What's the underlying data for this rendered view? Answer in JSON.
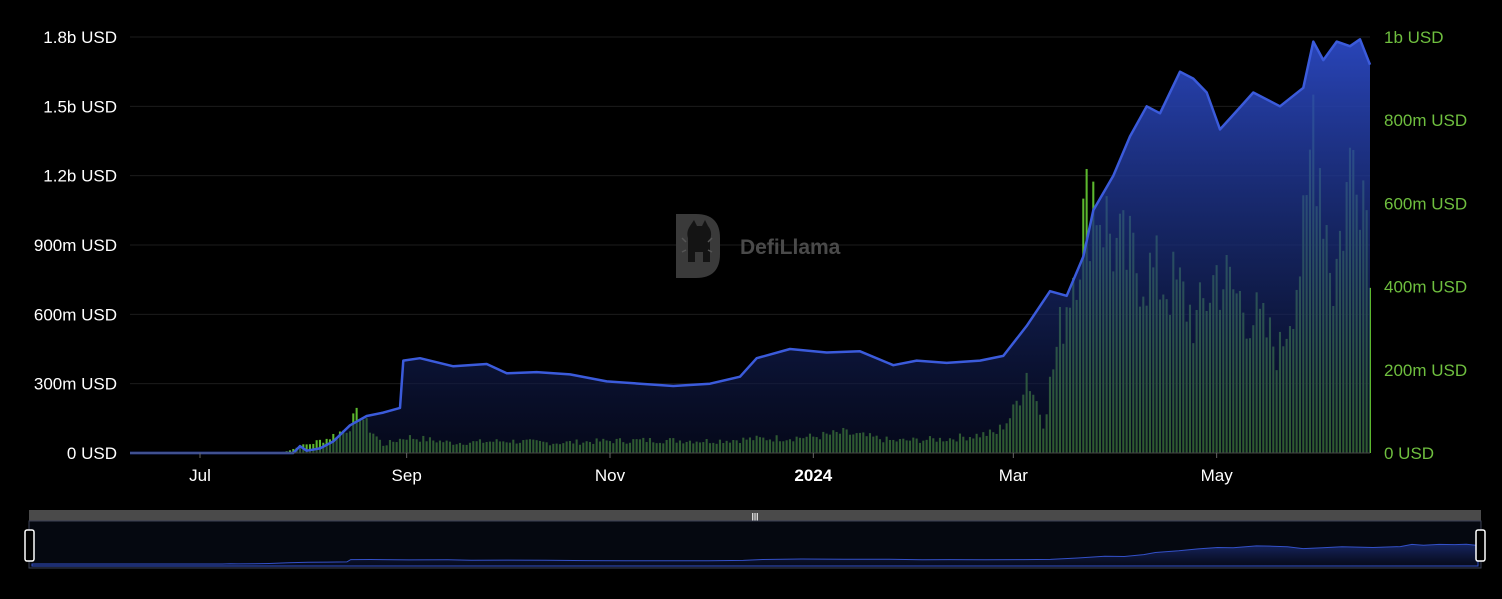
{
  "watermark": {
    "text": "DefiLlama",
    "icon": "llama-logo-icon"
  },
  "colors": {
    "background": "#000000",
    "tvl_line": "#3b5bdb",
    "tvl_fill_top": "#2a45b8",
    "volume_bar": "#5cb82e",
    "grid": "#1c1c1c",
    "left_axis_text": "#ffffff",
    "right_axis_text": "#6fbf3f"
  },
  "chart_data": {
    "type": "area",
    "title": "",
    "left_axis": {
      "unit": "USD",
      "ylim": [
        0,
        1800000000
      ],
      "tick_labels": [
        "0 USD",
        "300m USD",
        "600m USD",
        "900m USD",
        "1.2b USD",
        "1.5b USD",
        "1.8b USD"
      ]
    },
    "right_axis": {
      "unit": "USD",
      "ylim": [
        0,
        1000000000
      ],
      "tick_labels": [
        "0 USD",
        "200m USD",
        "400m USD",
        "600m USD",
        "800m USD",
        "1b USD"
      ]
    },
    "x_axis": {
      "tick_labels": [
        "Jul",
        "Sep",
        "Nov",
        "2024",
        "Mar",
        "May"
      ],
      "bold_tick": "2024",
      "xlim": [
        "2023-06-10",
        "2024-06-16"
      ]
    },
    "grid": true,
    "series": [
      {
        "kind": "area",
        "axis": "left",
        "points": [
          [
            "2023-06-10",
            0
          ],
          [
            "2023-07-01",
            0
          ],
          [
            "2023-07-20",
            0
          ],
          [
            "2023-07-29",
            0
          ],
          [
            "2023-07-31",
            30000000
          ],
          [
            "2023-08-02",
            10000000
          ],
          [
            "2023-08-06",
            20000000
          ],
          [
            "2023-08-10",
            50000000
          ],
          [
            "2023-08-15",
            120000000
          ],
          [
            "2023-08-20",
            160000000
          ],
          [
            "2023-08-25",
            175000000
          ],
          [
            "2023-08-30",
            195000000
          ],
          [
            "2023-08-31",
            400000000
          ],
          [
            "2023-09-05",
            410000000
          ],
          [
            "2023-09-15",
            375000000
          ],
          [
            "2023-09-25",
            385000000
          ],
          [
            "2023-10-01",
            345000000
          ],
          [
            "2023-10-10",
            350000000
          ],
          [
            "2023-10-20",
            340000000
          ],
          [
            "2023-10-31",
            310000000
          ],
          [
            "2023-11-10",
            300000000
          ],
          [
            "2023-11-20",
            290000000
          ],
          [
            "2023-12-01",
            300000000
          ],
          [
            "2023-12-10",
            330000000
          ],
          [
            "2023-12-15",
            410000000
          ],
          [
            "2023-12-25",
            450000000
          ],
          [
            "2024-01-05",
            435000000
          ],
          [
            "2024-01-15",
            440000000
          ],
          [
            "2024-01-25",
            380000000
          ],
          [
            "2024-02-01",
            400000000
          ],
          [
            "2024-02-10",
            390000000
          ],
          [
            "2024-02-20",
            400000000
          ],
          [
            "2024-02-27",
            420000000
          ],
          [
            "2024-03-05",
            550000000
          ],
          [
            "2024-03-12",
            700000000
          ],
          [
            "2024-03-17",
            680000000
          ],
          [
            "2024-03-22",
            850000000
          ],
          [
            "2024-03-25",
            1050000000
          ],
          [
            "2024-03-31",
            1200000000
          ],
          [
            "2024-04-05",
            1370000000
          ],
          [
            "2024-04-10",
            1500000000
          ],
          [
            "2024-04-14",
            1470000000
          ],
          [
            "2024-04-20",
            1650000000
          ],
          [
            "2024-04-24",
            1620000000
          ],
          [
            "2024-04-28",
            1560000000
          ],
          [
            "2024-05-02",
            1400000000
          ],
          [
            "2024-05-07",
            1480000000
          ],
          [
            "2024-05-12",
            1560000000
          ],
          [
            "2024-05-20",
            1500000000
          ],
          [
            "2024-05-27",
            1580000000
          ],
          [
            "2024-05-30",
            1780000000
          ],
          [
            "2024-06-02",
            1700000000
          ],
          [
            "2024-06-06",
            1780000000
          ],
          [
            "2024-06-10",
            1760000000
          ],
          [
            "2024-06-13",
            1790000000
          ],
          [
            "2024-06-16",
            1680000000
          ]
        ]
      },
      {
        "kind": "bar",
        "axis": "right",
        "points": [
          [
            "2023-07-25",
            0
          ],
          [
            "2023-08-01",
            18000000
          ],
          [
            "2023-08-08",
            35000000
          ],
          [
            "2023-08-14",
            60000000
          ],
          [
            "2023-08-18",
            100000000
          ],
          [
            "2023-08-20",
            70000000
          ],
          [
            "2023-08-25",
            20000000
          ],
          [
            "2023-09-01",
            40000000
          ],
          [
            "2023-09-15",
            25000000
          ],
          [
            "2023-10-01",
            30000000
          ],
          [
            "2023-10-15",
            25000000
          ],
          [
            "2023-11-01",
            30000000
          ],
          [
            "2023-11-15",
            32000000
          ],
          [
            "2023-12-01",
            30000000
          ],
          [
            "2023-12-15",
            35000000
          ],
          [
            "2024-01-01",
            40000000
          ],
          [
            "2024-01-10",
            50000000
          ],
          [
            "2024-01-25",
            30000000
          ],
          [
            "2024-02-10",
            35000000
          ],
          [
            "2024-02-25",
            50000000
          ],
          [
            "2024-03-01",
            100000000
          ],
          [
            "2024-03-05",
            200000000
          ],
          [
            "2024-03-10",
            80000000
          ],
          [
            "2024-03-15",
            300000000
          ],
          [
            "2024-03-20",
            500000000
          ],
          [
            "2024-03-25",
            660000000
          ],
          [
            "2024-04-01",
            500000000
          ],
          [
            "2024-04-10",
            450000000
          ],
          [
            "2024-04-20",
            400000000
          ],
          [
            "2024-04-25",
            320000000
          ],
          [
            "2024-05-01",
            450000000
          ],
          [
            "2024-05-10",
            360000000
          ],
          [
            "2024-05-20",
            250000000
          ],
          [
            "2024-05-28",
            550000000
          ],
          [
            "2024-05-30",
            870000000
          ],
          [
            "2024-06-05",
            420000000
          ],
          [
            "2024-06-12",
            810000000
          ],
          [
            "2024-06-16",
            550000000
          ]
        ]
      }
    ]
  },
  "navigator": {
    "handle_glyph": "|||"
  }
}
